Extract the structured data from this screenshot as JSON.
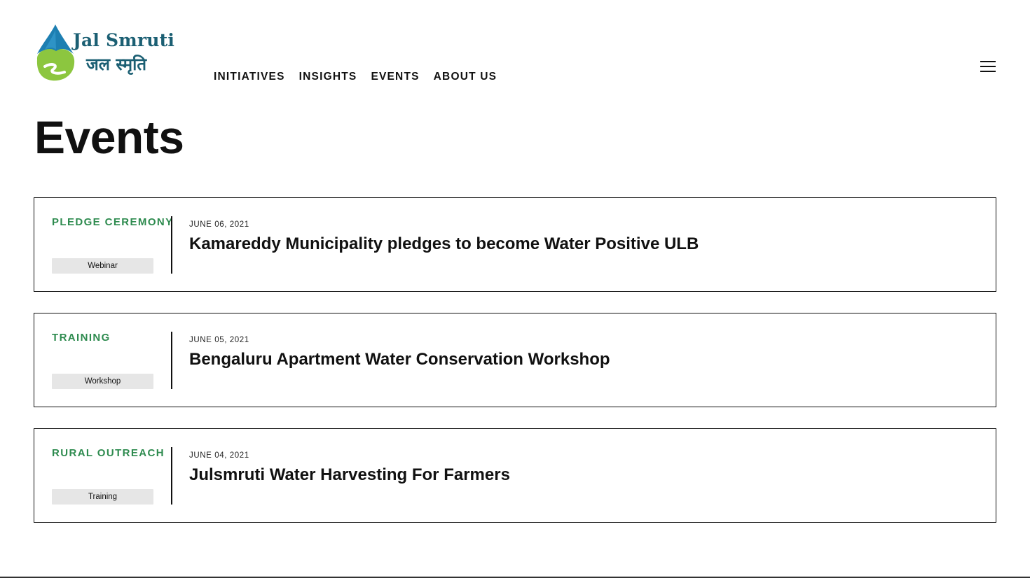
{
  "brand": {
    "name_en": "Jal Smruti",
    "name_hi": "जल स्मृति",
    "colors": {
      "primary": "#1b5f73",
      "drop": "#1d7fb2",
      "land": "#8cc63f",
      "accent": "#2e8b4f"
    }
  },
  "nav": {
    "items": [
      "INITIATIVES",
      "INSIGHTS",
      "EVENTS",
      "ABOUT US"
    ],
    "menu_icon": "hamburger-icon"
  },
  "page": {
    "title": "Events"
  },
  "events": [
    {
      "category": "PLEDGE CEREMONY",
      "tag": "Webinar",
      "date": "JUNE 06, 2021",
      "title": "Kamareddy Municipality pledges to become Water Positive ULB"
    },
    {
      "category": "TRAINING",
      "tag": "Workshop",
      "date": "JUNE 05, 2021",
      "title": "Bengaluru Apartment Water Conservation Workshop"
    },
    {
      "category": "RURAL OUTREACH",
      "tag": "Training",
      "date": "JUNE 04, 2021",
      "title": "Julsmruti Water Harvesting For Farmers"
    }
  ]
}
